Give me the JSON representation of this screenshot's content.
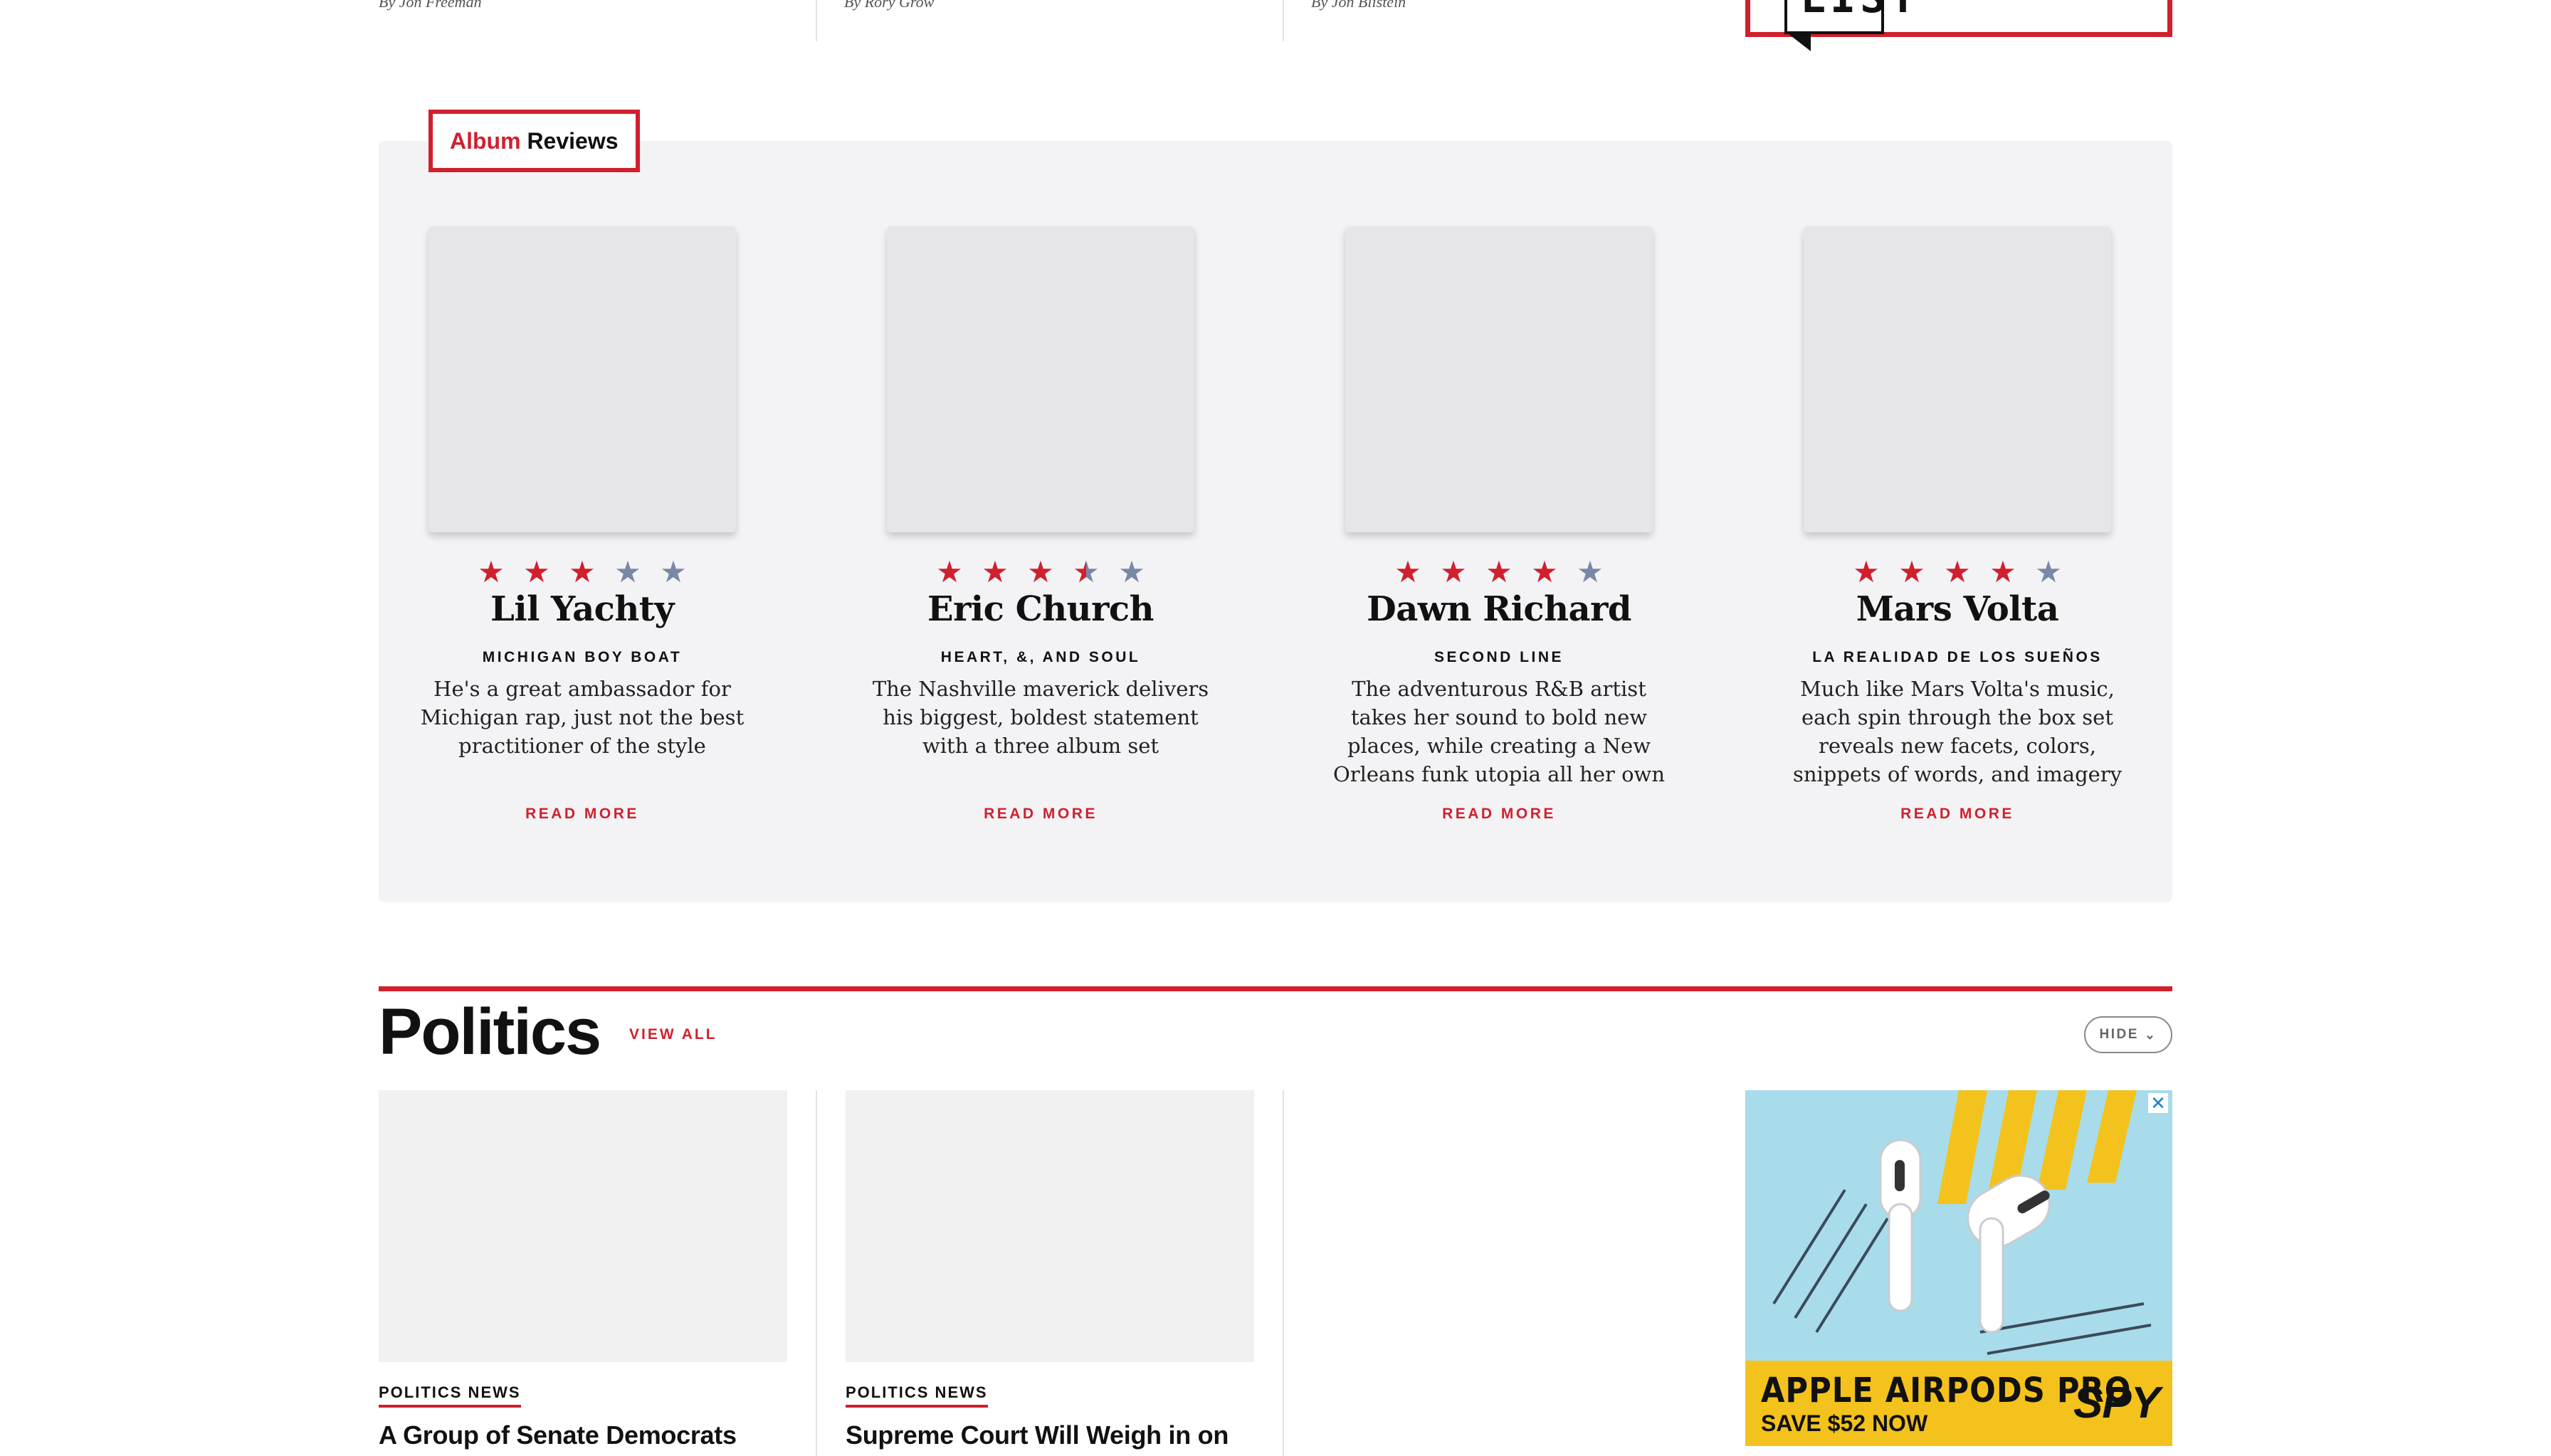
{
  "top": {
    "bylines": [
      "By Jon Freeman",
      "By Rory Grow",
      "By Jon Blistein"
    ],
    "list_badge": "LIST"
  },
  "album_reviews": {
    "tag_red": "Album",
    "tag_black": "Reviews",
    "cards": [
      {
        "artist": "Lil Yachty",
        "album": "MICHIGAN BOY BOAT",
        "rating": 3,
        "blurb": "He's a great ambassador for Michigan rap, just not the best practitioner of the style",
        "read_more": "READ MORE"
      },
      {
        "artist": "Eric Church",
        "album": "HEART, &, AND SOUL",
        "rating": 3.5,
        "blurb": "The Nashville maverick delivers his biggest, boldest statement with a three album set",
        "read_more": "READ MORE"
      },
      {
        "artist": "Dawn Richard",
        "album": "SECOND LINE",
        "rating": 4,
        "blurb": "The adventurous R&B artist takes her sound to bold new places, while creating a New Orleans funk utopia all her own",
        "read_more": "READ MORE"
      },
      {
        "artist": "Mars Volta",
        "album": "LA REALIDAD DE LOS SUEÑOS",
        "rating": 4,
        "blurb": "Much like Mars Volta's music, each spin through the box set reveals new facets, colors, snippets of words, and imagery",
        "read_more": "READ MORE"
      }
    ],
    "star_colors": {
      "on": "#d0202e",
      "off": "#7a88a8"
    }
  },
  "politics": {
    "title": "Politics",
    "view_all": "VIEW ALL",
    "hide_label": "HIDE",
    "articles": [
      {
        "category": "POLITICS NEWS",
        "headline": "A Group of Senate Democrats"
      },
      {
        "category": "POLITICS NEWS",
        "headline": "Supreme Court Will Weigh in on"
      }
    ]
  },
  "ad": {
    "headline": "APPLE AIRPODS PRO",
    "sub": "SAVE $52 NOW",
    "logo": "SPY",
    "close": "✕"
  },
  "colors": {
    "accent": "#d0202e",
    "panel": "#f3f3f5"
  }
}
